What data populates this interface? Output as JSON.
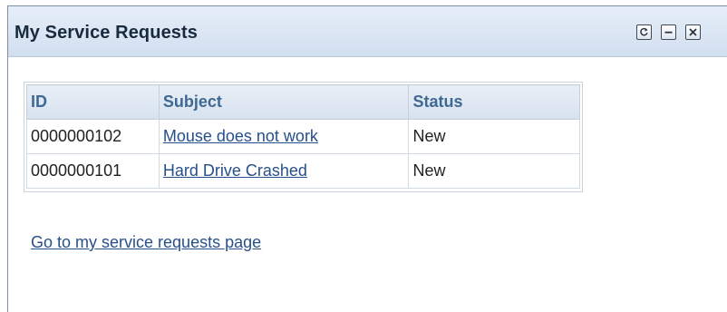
{
  "pagelet": {
    "title": "My Service Requests",
    "controls": {
      "refresh_icon": "refresh-icon",
      "minimize_icon": "minimize-icon",
      "close_icon": "close-icon"
    }
  },
  "table": {
    "headers": [
      "ID",
      "Subject",
      "Status"
    ],
    "rows": [
      {
        "id": "0000000102",
        "subject": "Mouse does not work",
        "status": "New"
      },
      {
        "id": "0000000101",
        "subject": "Hard Drive Crashed",
        "status": "New"
      }
    ]
  },
  "footer": {
    "link_label": "Go to my service requests page"
  },
  "colors": {
    "header_bg": "#d2dff0",
    "title_text": "#1a2a3e",
    "column_header_text": "#3f6993",
    "link": "#26508a"
  }
}
